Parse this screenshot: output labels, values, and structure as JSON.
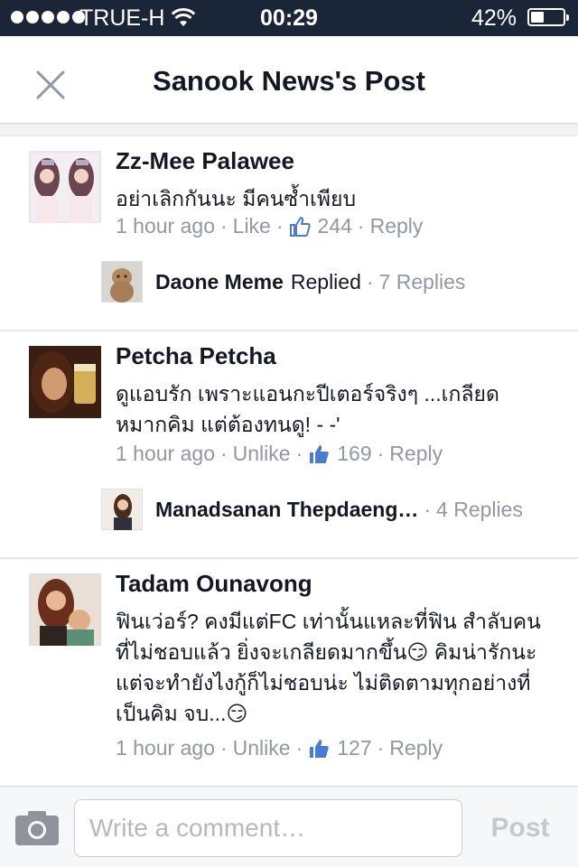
{
  "status_bar": {
    "carrier": "TRUE-H",
    "time": "00:29",
    "battery_percent_text": "42%",
    "battery_level": 0.42,
    "icons": [
      "signal-dots-icon",
      "wifi-icon",
      "battery-icon"
    ]
  },
  "header": {
    "title": "Sanook News's Post",
    "close_icon": "close-icon"
  },
  "comments": [
    {
      "author": "Zz-Mee Palawee",
      "text": "อย่าเลิกกันนะ มีคนซ้ำเพียบ",
      "time": "1 hour ago",
      "like_action": "Like",
      "like_count": "244",
      "reply_action": "Reply",
      "reply": {
        "name": "Daone Meme",
        "verb": "Replied",
        "count": "7 Replies"
      }
    },
    {
      "author": "Petcha Petcha",
      "text": "ดูแอบรัก เพราะแอนกะปีเตอร์จริงๆ ...เกลียดหมากคิม แต่ต้องทนดู!   - -'",
      "time": "1 hour ago",
      "like_action": "Unlike",
      "like_count": "169",
      "reply_action": "Reply",
      "reply": {
        "name": "Manadsanan Thepdaeng…",
        "verb": "",
        "count": "4 Replies"
      }
    },
    {
      "author": "Tadam Ounavong",
      "text": "ฟินเว่อร์? คงมีแต่FC เท่านั้นแหละที่ฟิน สำลับคนที่ไม่ชอบแล้ว ยิ่งจะเกลียดมากขึ้น😏 คิมน่ารักนะ แต่จะทำยังไงกู้ก็ไม่ชอบน่ะ ไม่ติดตามทุกอย่างที่เป็นคิม จบ...😏",
      "time": "1 hour ago",
      "like_action": "Unlike",
      "like_count": "127",
      "reply_action": "Reply"
    }
  ],
  "composer": {
    "camera_icon": "camera-icon",
    "placeholder": "Write a comment…",
    "value": "",
    "post_label": "Post"
  },
  "colors": {
    "status_bar_bg": "#1b2538",
    "text_primary": "#141823",
    "text_meta": "#9197a3",
    "like_blue": "#4a7bd0",
    "post_disabled": "#c4c8cf"
  }
}
